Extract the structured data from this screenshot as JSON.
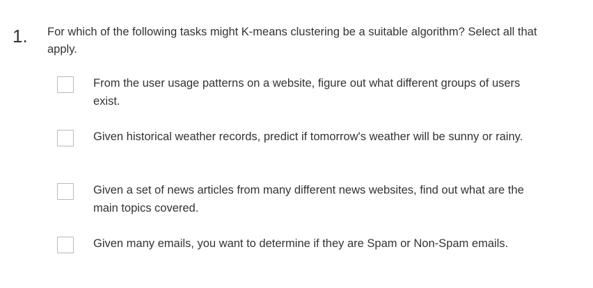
{
  "question": {
    "number": "1.",
    "prompt": "For which of the following tasks might K-means clustering be a suitable algorithm? Select all that apply.",
    "options": [
      {
        "label": "From the user usage patterns on a website, figure out what different groups of users exist.",
        "checked": false
      },
      {
        "label": "Given historical weather records, predict if tomorrow's weather will be sunny or rainy.",
        "checked": false
      },
      {
        "label": "Given a set of news articles from many different news websites, find out what are the main topics covered.",
        "checked": false
      },
      {
        "label": "Given many emails, you want to determine if they are Spam or Non-Spam emails.",
        "checked": false
      }
    ]
  }
}
